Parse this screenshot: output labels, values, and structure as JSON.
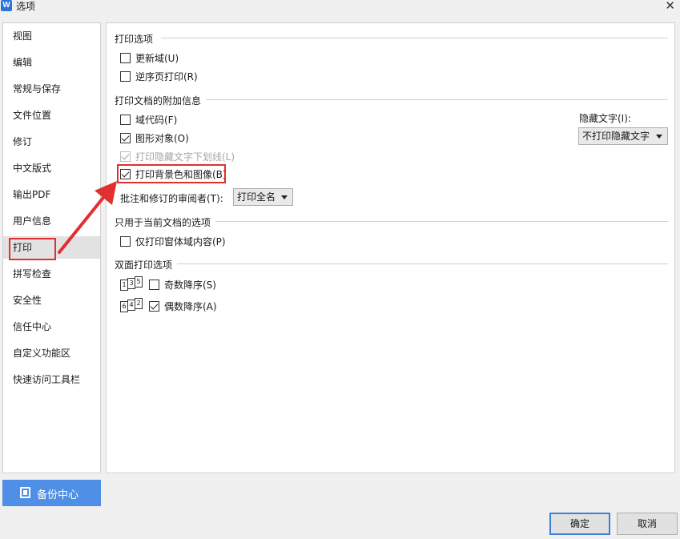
{
  "window": {
    "title": "选项",
    "app_icon_letter": "W",
    "close_glyph": "✕"
  },
  "sidebar": {
    "items": [
      {
        "label": "视图"
      },
      {
        "label": "编辑"
      },
      {
        "label": "常规与保存"
      },
      {
        "label": "文件位置"
      },
      {
        "label": "修订"
      },
      {
        "label": "中文版式"
      },
      {
        "label": "输出PDF"
      },
      {
        "label": "用户信息"
      },
      {
        "label": "打印",
        "selected": true
      },
      {
        "label": "拼写检查"
      },
      {
        "label": "安全性"
      },
      {
        "label": "信任中心"
      },
      {
        "label": "自定义功能区"
      },
      {
        "label": "快速访问工具栏"
      }
    ],
    "backup_label": "备份中心"
  },
  "content": {
    "print_options": {
      "title": "打印选项",
      "update_fields": {
        "label": "更新域(U)",
        "checked": false
      },
      "reverse_order": {
        "label": "逆序页打印(R)",
        "checked": false
      }
    },
    "extra_info": {
      "title": "打印文档的附加信息",
      "field_codes": {
        "label": "域代码(F)",
        "checked": false
      },
      "drawing_objects": {
        "label": "图形对象(O)",
        "checked": true
      },
      "hidden_underline": {
        "label": "打印隐藏文字下划线(L)",
        "checked": true,
        "disabled": true
      },
      "background": {
        "label": "打印背景色和图像(B)",
        "checked": true
      },
      "hidden_text_label": "隐藏文字(I):",
      "hidden_text_value": "不打印隐藏文字",
      "reviewer_label": "批注和修订的审阅者(T):",
      "reviewer_value": "打印全名"
    },
    "current_doc": {
      "title": "只用于当前文档的选项",
      "form_data_only": {
        "label": "仅打印窗体域内容(P)",
        "checked": false
      }
    },
    "duplex": {
      "title": "双面打印选项",
      "odd_icon_pages": [
        "1",
        "3",
        "5"
      ],
      "even_icon_pages": [
        "6",
        "4",
        "2"
      ],
      "odd_reverse": {
        "label": "奇数降序(S)",
        "checked": false
      },
      "even_reverse": {
        "label": "偶数降序(A)",
        "checked": true
      }
    }
  },
  "footer": {
    "ok_label": "确定",
    "cancel_label": "取消"
  },
  "colors": {
    "accent_blue": "#4f8fe6",
    "highlight_red": "#e03030"
  }
}
